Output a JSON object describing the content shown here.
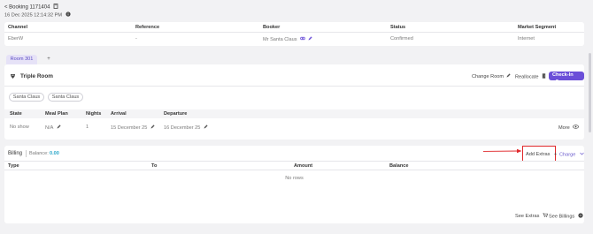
{
  "header": {
    "back_label": "< Booking 1171404",
    "datetime": "16 Dec 2025 12:14:32 PM"
  },
  "booking_table": {
    "columns": [
      "Channel",
      "Reference",
      "Booker",
      "Status",
      "Market Segment"
    ],
    "row": [
      "EberW",
      "-",
      "Mr Santa Claus",
      "Confirmed",
      "Internet"
    ]
  },
  "room_tabs": {
    "active_tab": "Room 301",
    "add_label": "+"
  },
  "room": {
    "type": "Triple Room",
    "change_room_label": "Change Room",
    "reallocate_label": "Reallocate",
    "checkin_label": "Check-In",
    "guests": [
      "Santa Claus",
      "Santa Claus"
    ]
  },
  "stay_table": {
    "columns": [
      "State",
      "Meal Plan",
      "Nights",
      "Arrival",
      "Departure"
    ],
    "row": [
      "No show",
      "N/A",
      "1",
      "15 December 25",
      "16 December 25"
    ],
    "more_label": "More"
  },
  "billing": {
    "title": "Billing",
    "balance_label": "Balance:",
    "balance_value": "0.00",
    "add_extras_label": "Add Extras",
    "charge_label": "Charge",
    "columns": [
      "Type",
      "To",
      "Amount",
      "Balance"
    ],
    "empty_text": "No rows",
    "see_extras_label": "See Extras",
    "see_billings_label": "See Billings"
  },
  "colors": {
    "accent": "#6b4fd8",
    "balance": "#2aa7c9",
    "annotation": "#e0282b"
  }
}
